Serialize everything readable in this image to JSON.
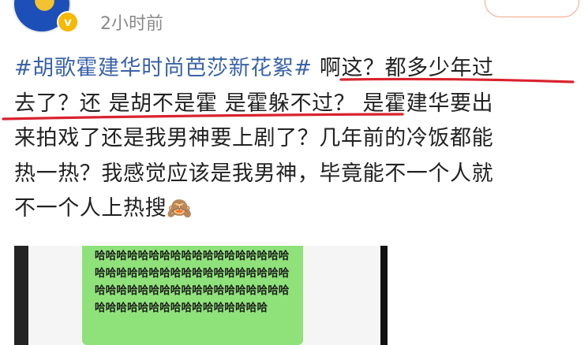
{
  "meta": {
    "time_ago": "2小时前"
  },
  "post": {
    "lines": [
      {
        "topic": "#胡歌霍建华时尚芭莎新花絮#",
        "text": " 啊这？都多少年过"
      },
      {
        "text": "去了？还 是胡不是霍 是霍躲不过？ 是霍建华要出"
      },
      {
        "text": "来拍戏了还是我男神要上剧了？几年前的冷饭都能"
      },
      {
        "text": "热一热？我感觉应该是我男神，毕竟能不一个人就"
      },
      {
        "text": "不一个人上热搜",
        "emoji": "🙈"
      }
    ]
  },
  "media": {
    "message": "哈哈哈哈哈哈哈哈哈哈哈哈哈哈哈哈哈哈哈哈哈哈哈哈哈哈哈哈哈哈哈哈哈哈哈哈哈哈哈哈哈哈哈哈哈哈哈哈哈哈哈哈哈哈哈哈哈哈哈哈哈哈哈哈哈哈哈哈哈哈"
  },
  "colors": {
    "topic": "#3a63a8",
    "highlight": "#d9232e",
    "bubble": "#8fe27a"
  },
  "icons": {
    "avatar_badge": "v-verified-icon",
    "emoji": "see-no-evil-monkey"
  }
}
